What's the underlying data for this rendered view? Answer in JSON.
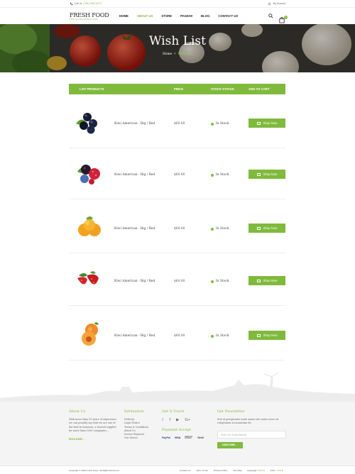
{
  "topbar": {
    "call_label": "Call us",
    "phone": "(+84) 0983 69 97",
    "account": "My Account"
  },
  "header": {
    "logo_main": "FRESH FOOD",
    "logo_sub": "100% NATURE ORGANIC 100%",
    "nav": [
      "HOME",
      "ABOUT US",
      "STORE",
      "PAGES",
      "BLOG",
      "CONTACT US"
    ],
    "cart_count": "0"
  },
  "banner": {
    "title": "Wish List",
    "crumb_home": "Home",
    "crumb_current": "Wish List"
  },
  "table": {
    "headers": [
      "LIST PRODUCTS",
      "PRICE",
      "STOCK STATUS",
      "ADD TO CART"
    ],
    "rows": [
      {
        "product": "Kiwi American - Big / Red",
        "price": "$60.00",
        "stock": "In Stock",
        "button": "Shop Now",
        "image": "blueberries"
      },
      {
        "product": "Kiwi American - Big / Red",
        "price": "$60.00",
        "stock": "In Stock",
        "button": "Shop Now",
        "image": "mixed-berries"
      },
      {
        "product": "Kiwi American - Big / Red",
        "price": "$60.00",
        "stock": "In Stock",
        "button": "Shop Now",
        "image": "apricots"
      },
      {
        "product": "Kiwi American - Big / Red",
        "price": "$60.00",
        "stock": "In Stock",
        "button": "Shop Now",
        "image": "strawberries"
      },
      {
        "product": "Kiwi American - Big / Red",
        "price": "$60.00",
        "stock": "In Stock",
        "button": "Shop Now",
        "image": "peaches"
      }
    ]
  },
  "footer": {
    "about_title": "About Us",
    "about_text": [
      "With more than 15 years of experience",
      "we can proudly say that we are one of",
      "the best in business, a trusted supplier",
      "for more than 1000 companies..."
    ],
    "read_more": "READ MORE",
    "info_title": "Infomation",
    "info_links": [
      "Delivery",
      "Legal Notice",
      "Terms & Conditions",
      "About Us",
      "Secure Payment",
      "Our Stores"
    ],
    "touch_title": "Get It Touch",
    "social_icons": [
      "twitter-icon",
      "facebook-icon",
      "youtube-icon",
      "google-plus-icon"
    ],
    "payment_title": "Payment Accept",
    "payments": [
      "PayPal",
      "VISA",
      "American Express",
      "Skrill"
    ],
    "newsletter_title": "Get Newsletter",
    "newsletter_text": [
      "Sed ut perspiciatis unde omnis iste natus error sit",
      "voluptatem accusantium do"
    ],
    "newsletter_placeholder": "Enter Your Email Address",
    "subscribe": "SUBSCRIBE"
  },
  "bottom": {
    "copyright": "Copyright © 2016 Fresh Food - All Rights Reserved",
    "links": [
      "Contact Us",
      "Term of Use",
      "Privacy Policy",
      "Site Map"
    ],
    "language_label": "Language:",
    "language": "ENG",
    "price_label": "Price:",
    "currency": "USD"
  },
  "colors": {
    "accent": "#7fba3c",
    "text": "#333333",
    "footer_bg": "#f4f4f4"
  }
}
